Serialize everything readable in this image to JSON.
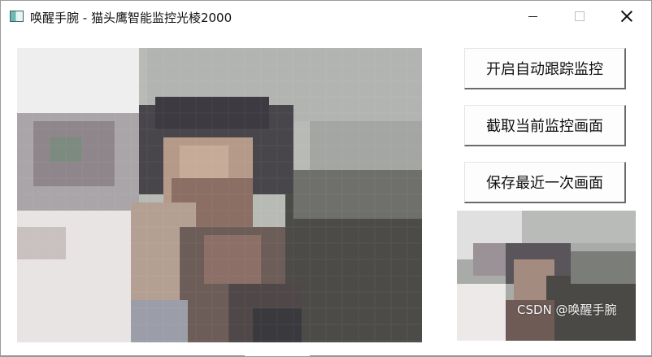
{
  "window": {
    "title": "唤醒手腕 - 猫头鹰智能监控光棱2000",
    "controls": [
      "minimize",
      "maximize",
      "close"
    ]
  },
  "video_feed": {
    "description_icon": "camera-feed",
    "palette": {
      "wall": "#b7b9b4",
      "shadow": "#55524e",
      "skin": "#b99a88",
      "hair": "#3f3c45"
    }
  },
  "buttons": {
    "start_tracking": "开启自动跟踪监控",
    "capture_frame": "截取当前监控画面",
    "save_latest": "保存最近一次画面"
  },
  "watermark": "CSDN @唤醒手腕"
}
